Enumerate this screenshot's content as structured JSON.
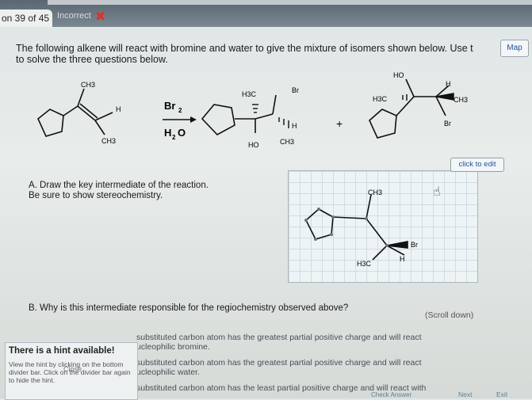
{
  "header": {
    "question_counter": "on 39 of 45",
    "status": "Incorrect"
  },
  "prompt": {
    "line1": "The following alkene will react with bromine and water to give the mixture of isomers shown below. Use t",
    "line2": "to solve the three questions below."
  },
  "map_button": "Map",
  "reaction": {
    "reactant": {
      "ch3_top": "CH3",
      "h": "H",
      "ch3_bottom": "CH3"
    },
    "reagents": {
      "top": "Br",
      "top_sub": "2",
      "bottom": "H",
      "bottom_sub": "2",
      "bottom_tail": "O"
    },
    "product1": {
      "h3c": "H3C",
      "br": "Br",
      "ho": "HO",
      "h": "H",
      "ch3": "CH3"
    },
    "plus": "+",
    "product2": {
      "ho": "HO",
      "h": "H",
      "h3c": "H3C",
      "ch3": "CH3",
      "br": "Br"
    }
  },
  "partA": {
    "line1": "A. Draw the key intermediate of the reaction.",
    "line2": "Be sure to show stereochemistry."
  },
  "click_to_edit": "click to edit",
  "editor": {
    "ch3": "CH3",
    "br": "Br",
    "h3c": "H3C",
    "h": "H"
  },
  "partB": "B. Why is this intermediate responsible for the regiochemistry observed above?",
  "scroll_hint": "(Scroll down)",
  "hint": {
    "title": "There is a hint available!",
    "body": "View the hint by clicking on the bottom divider bar. Click on the divider bar again to hide the hint.",
    "close": "Close"
  },
  "choices": [
    {
      "l1": "substituted carbon atom has the greatest partial positive charge and will react",
      "l2": "ucleophilic bromine."
    },
    {
      "l1": "substituted carbon atom has the greatest partial positive charge and will react",
      "l2": "ucleophilic water."
    },
    {
      "l1": "substituted carbon atom has the least partial positive charge and will react with",
      "l2": ""
    }
  ],
  "nav": {
    "check": "Check Answer",
    "next": "Next",
    "exit": "Exit"
  }
}
